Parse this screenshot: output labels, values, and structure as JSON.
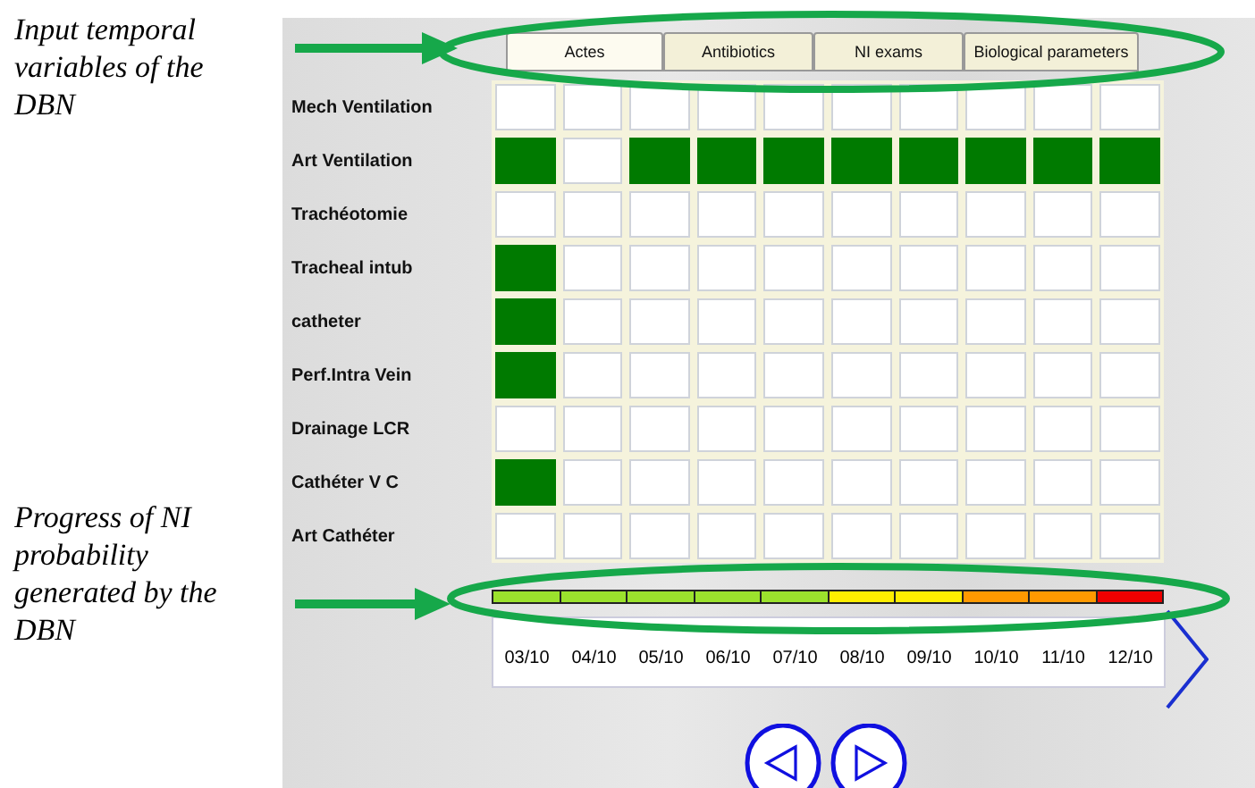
{
  "annotations": [
    {
      "text": "Input temporal variables of the DBN"
    },
    {
      "text": "Progress of NI probability generated by the DBN"
    }
  ],
  "tabs": [
    {
      "label": "Actes",
      "selected": true
    },
    {
      "label": "Antibiotics",
      "selected": false
    },
    {
      "label": "NI exams",
      "selected": false
    },
    {
      "label": "Biological parameters",
      "selected": false
    }
  ],
  "rows": [
    {
      "label": "Mech Ventilation",
      "cells": [
        false,
        false,
        false,
        false,
        false,
        false,
        false,
        false,
        false,
        false
      ]
    },
    {
      "label": "Art Ventilation",
      "cells": [
        true,
        false,
        true,
        true,
        true,
        true,
        true,
        true,
        true,
        true
      ]
    },
    {
      "label": "Trachéotomie",
      "cells": [
        false,
        false,
        false,
        false,
        false,
        false,
        false,
        false,
        false,
        false
      ]
    },
    {
      "label": "Tracheal intub",
      "cells": [
        true,
        false,
        false,
        false,
        false,
        false,
        false,
        false,
        false,
        false
      ]
    },
    {
      "label": "catheter",
      "cells": [
        true,
        false,
        false,
        false,
        false,
        false,
        false,
        false,
        false,
        false
      ]
    },
    {
      "label": "Perf.Intra Vein",
      "cells": [
        true,
        false,
        false,
        false,
        false,
        false,
        false,
        false,
        false,
        false
      ]
    },
    {
      "label": "Drainage LCR",
      "cells": [
        false,
        false,
        false,
        false,
        false,
        false,
        false,
        false,
        false,
        false
      ]
    },
    {
      "label": "Cathéter V C",
      "cells": [
        true,
        false,
        false,
        false,
        false,
        false,
        false,
        false,
        false,
        false
      ]
    },
    {
      "label": "Art Cathéter",
      "cells": [
        false,
        false,
        false,
        false,
        false,
        false,
        false,
        false,
        false,
        false
      ]
    }
  ],
  "probability_bar": [
    {
      "color": "#9be22d"
    },
    {
      "color": "#9be22d"
    },
    {
      "color": "#9be22d"
    },
    {
      "color": "#9be22d"
    },
    {
      "color": "#9be22d"
    },
    {
      "color": "#ffee00"
    },
    {
      "color": "#ffee00"
    },
    {
      "color": "#ff9900"
    },
    {
      "color": "#ff9900"
    },
    {
      "color": "#ee0000"
    }
  ],
  "dates": [
    "03/10",
    "04/10",
    "05/10",
    "06/10",
    "07/10",
    "08/10",
    "09/10",
    "10/10",
    "11/10",
    "12/10"
  ]
}
